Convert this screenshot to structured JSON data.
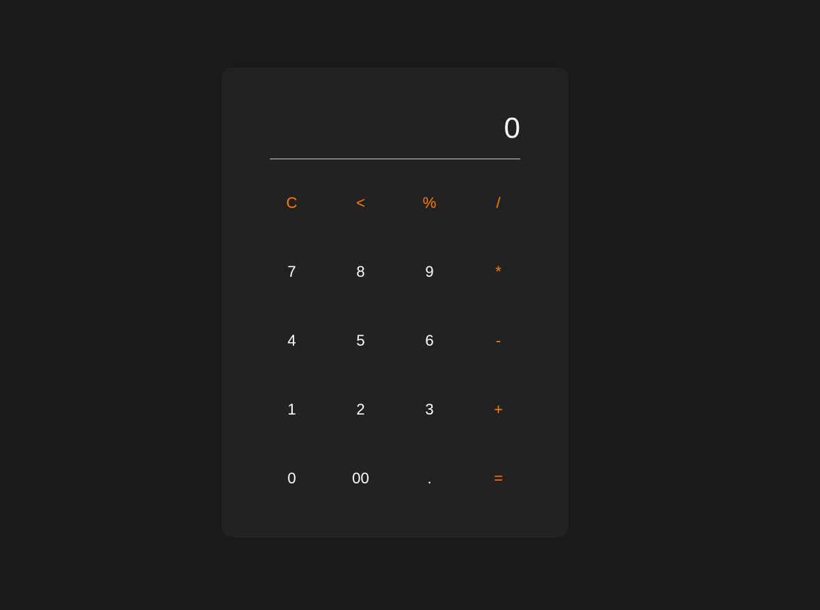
{
  "display": {
    "value": "0"
  },
  "keys": [
    {
      "label": "C",
      "type": "op",
      "name": "clear-button"
    },
    {
      "label": "<",
      "type": "op",
      "name": "backspace-button"
    },
    {
      "label": "%",
      "type": "op",
      "name": "percent-button"
    },
    {
      "label": "/",
      "type": "op",
      "name": "divide-button"
    },
    {
      "label": "7",
      "type": "digit",
      "name": "digit-7-button"
    },
    {
      "label": "8",
      "type": "digit",
      "name": "digit-8-button"
    },
    {
      "label": "9",
      "type": "digit",
      "name": "digit-9-button"
    },
    {
      "label": "*",
      "type": "op",
      "name": "multiply-button"
    },
    {
      "label": "4",
      "type": "digit",
      "name": "digit-4-button"
    },
    {
      "label": "5",
      "type": "digit",
      "name": "digit-5-button"
    },
    {
      "label": "6",
      "type": "digit",
      "name": "digit-6-button"
    },
    {
      "label": "-",
      "type": "op",
      "name": "subtract-button"
    },
    {
      "label": "1",
      "type": "digit",
      "name": "digit-1-button"
    },
    {
      "label": "2",
      "type": "digit",
      "name": "digit-2-button"
    },
    {
      "label": "3",
      "type": "digit",
      "name": "digit-3-button"
    },
    {
      "label": "+",
      "type": "op",
      "name": "add-button"
    },
    {
      "label": "0",
      "type": "digit",
      "name": "digit-0-button"
    },
    {
      "label": "00",
      "type": "digit",
      "name": "double-zero-button"
    },
    {
      "label": ".",
      "type": "digit",
      "name": "decimal-button"
    },
    {
      "label": "=",
      "type": "op",
      "name": "equals-button"
    }
  ],
  "colors": {
    "background": "#1c1c1c",
    "panel": "#222222",
    "accent": "#ff7a00",
    "text": "#ffffff",
    "divider": "#cfcfcf"
  }
}
